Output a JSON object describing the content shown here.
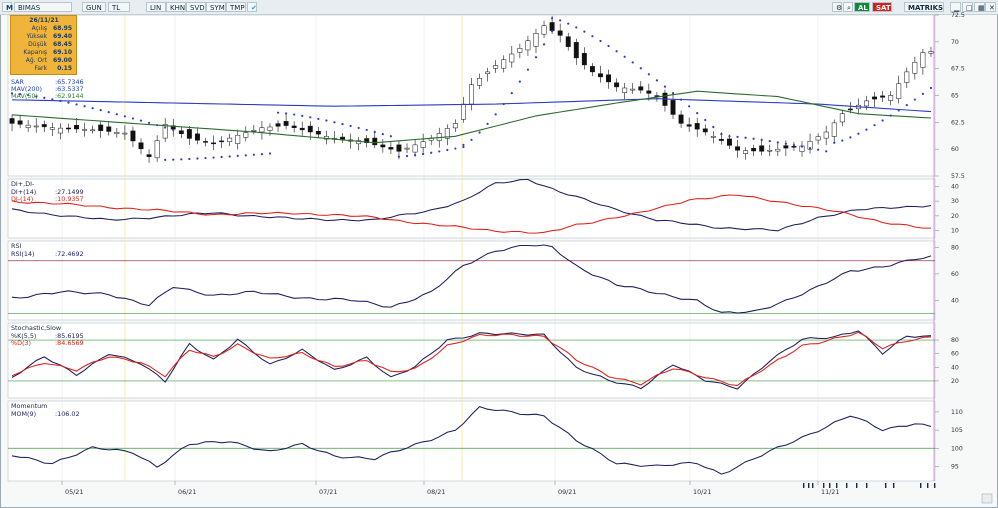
{
  "toolbar": {
    "logo": "M",
    "symbol": "BIMAS",
    "buttons": [
      "GUN",
      "TL",
      "LIN",
      "KHN",
      "SVD",
      "SYM",
      "TMP"
    ],
    "right_al": "AL",
    "right_sat": "SAT",
    "right_matriks": "MATRIKS",
    "colors": {
      "al": "#0c8a34",
      "sat": "#d6201d"
    }
  },
  "info_box": {
    "date": "26/11/21",
    "rows": [
      {
        "label": "Açılış",
        "value": "68.95"
      },
      {
        "label": "Yüksek",
        "value": "69.40"
      },
      {
        "label": "Düşük",
        "value": "68.45"
      },
      {
        "label": "Kapanış",
        "value": "69.10"
      },
      {
        "label": "Ağ. Ort",
        "value": "69.00"
      },
      {
        "label": "Fark",
        "value": "0.15"
      }
    ]
  },
  "x_axis": {
    "labels": [
      "05/21",
      "06/21",
      "07/21",
      "08/21",
      "09/21",
      "10/21",
      "11/21"
    ]
  },
  "chart_data": [
    {
      "type": "candlestick",
      "title": "",
      "legend": [
        {
          "name": "SAR",
          "value": ":65.7346",
          "color": "#1f3fbf"
        },
        {
          "name": "MAV(200)",
          "value": ":63.5337",
          "color": "#1f3fbf"
        },
        {
          "name": "MAV(50)",
          "value": ":62.9144",
          "color": "#2f7d32"
        }
      ],
      "ylim": [
        57.5,
        72.5
      ],
      "yticks": [
        57.5,
        60,
        62.5,
        65,
        67.5,
        70,
        72.5
      ],
      "n": 115,
      "close_anchors": [
        [
          0,
          62.4
        ],
        [
          5,
          62.0
        ],
        [
          10,
          61.8
        ],
        [
          14,
          61.5
        ],
        [
          17,
          59.3
        ],
        [
          19,
          62.3
        ],
        [
          22,
          61.0
        ],
        [
          25,
          60.5
        ],
        [
          28,
          61.3
        ],
        [
          31,
          62.0
        ],
        [
          34,
          62.2
        ],
        [
          37,
          61.6
        ],
        [
          40,
          61.0
        ],
        [
          43,
          60.8
        ],
        [
          46,
          60.2
        ],
        [
          48,
          59.8
        ],
        [
          52,
          61.0
        ],
        [
          55,
          62.4
        ],
        [
          57,
          66.0
        ],
        [
          60,
          67.8
        ],
        [
          63,
          69.4
        ],
        [
          66,
          71.5
        ],
        [
          68,
          70.6
        ],
        [
          70,
          68.5
        ],
        [
          72,
          67.2
        ],
        [
          75,
          65.8
        ],
        [
          78,
          65.5
        ],
        [
          80,
          64.9
        ],
        [
          83,
          62.4
        ],
        [
          86,
          61.6
        ],
        [
          88,
          60.8
        ],
        [
          90,
          59.9
        ],
        [
          93,
          59.8
        ],
        [
          95,
          60.0
        ],
        [
          98,
          60.3
        ],
        [
          101,
          61.6
        ],
        [
          103,
          63.3
        ],
        [
          106,
          64.5
        ],
        [
          109,
          65.0
        ],
        [
          111,
          67.2
        ],
        [
          113,
          69.0
        ],
        [
          114,
          69.1
        ]
      ],
      "mav200": [
        [
          0,
          64.6
        ],
        [
          20,
          64.3
        ],
        [
          40,
          64.0
        ],
        [
          60,
          64.2
        ],
        [
          80,
          64.7
        ],
        [
          100,
          64.2
        ],
        [
          114,
          63.5
        ]
      ],
      "mav50": [
        [
          0,
          63.2
        ],
        [
          15,
          62.4
        ],
        [
          30,
          61.6
        ],
        [
          45,
          60.6
        ],
        [
          55,
          61.2
        ],
        [
          65,
          63.1
        ],
        [
          75,
          64.3
        ],
        [
          85,
          65.4
        ],
        [
          95,
          64.9
        ],
        [
          105,
          63.3
        ],
        [
          114,
          62.9
        ]
      ],
      "sar_segments": [
        {
          "from": 0,
          "to": 20,
          "start": 65.2,
          "end": 61.8
        },
        {
          "from": 19,
          "to": 32,
          "start": 59.0,
          "end": 59.6
        },
        {
          "from": 33,
          "to": 47,
          "start": 63.4,
          "end": 61.2
        },
        {
          "from": 48,
          "to": 56,
          "start": 59.3,
          "end": 60.2
        },
        {
          "from": 56,
          "to": 67,
          "start": 60.4,
          "end": 71.0
        },
        {
          "from": 67,
          "to": 88,
          "start": 72.2,
          "end": 61.4
        },
        {
          "from": 89,
          "to": 101,
          "start": 61.2,
          "end": 59.8
        },
        {
          "from": 102,
          "to": 114,
          "start": 60.6,
          "end": 65.7
        }
      ]
    },
    {
      "type": "line",
      "title": "DI+,DI-",
      "legend": [
        {
          "name": "DI+(14)",
          "value": ":27.1499",
          "color": "#1b1f5e"
        },
        {
          "name": "DI-(14)",
          "value": ":10.9357",
          "color": "#e0201a"
        }
      ],
      "ylim": [
        5,
        45
      ],
      "yticks": [
        10,
        20,
        30,
        40
      ],
      "series": [
        {
          "name": "DI+(14)",
          "anchors": [
            [
              0,
              24
            ],
            [
              12,
              17
            ],
            [
              25,
              22
            ],
            [
              35,
              18
            ],
            [
              45,
              17
            ],
            [
              52,
              24
            ],
            [
              56,
              30
            ],
            [
              60,
              42
            ],
            [
              64,
              45
            ],
            [
              68,
              36
            ],
            [
              74,
              26
            ],
            [
              80,
              17
            ],
            [
              88,
              12
            ],
            [
              95,
              10
            ],
            [
              100,
              19
            ],
            [
              105,
              24
            ],
            [
              110,
              26
            ],
            [
              114,
              27.1
            ]
          ]
        },
        {
          "name": "DI-(14)",
          "anchors": [
            [
              0,
              30
            ],
            [
              12,
              26
            ],
            [
              25,
              21
            ],
            [
              35,
              22
            ],
            [
              45,
              19
            ],
            [
              52,
              14
            ],
            [
              60,
              10
            ],
            [
              66,
              8
            ],
            [
              70,
              14
            ],
            [
              78,
              22
            ],
            [
              84,
              31
            ],
            [
              90,
              34
            ],
            [
              96,
              29
            ],
            [
              103,
              22
            ],
            [
              108,
              16
            ],
            [
              114,
              10.9
            ]
          ]
        }
      ]
    },
    {
      "type": "line",
      "title": "RSI",
      "legend": [
        {
          "name": "RSI(14)",
          "value": ":72.4692",
          "color": "#1b1f5e"
        }
      ],
      "ylim": [
        25,
        85
      ],
      "yticks": [
        40,
        60,
        80
      ],
      "reference_lines": [
        70,
        30
      ],
      "series": [
        {
          "name": "RSI(14)",
          "anchors": [
            [
              0,
              42
            ],
            [
              6,
              46
            ],
            [
              12,
              45
            ],
            [
              17,
              36
            ],
            [
              20,
              50
            ],
            [
              25,
              44
            ],
            [
              30,
              46
            ],
            [
              36,
              42
            ],
            [
              42,
              40
            ],
            [
              47,
              35
            ],
            [
              52,
              46
            ],
            [
              56,
              66
            ],
            [
              60,
              78
            ],
            [
              64,
              82
            ],
            [
              67,
              80
            ],
            [
              70,
              66
            ],
            [
              75,
              52
            ],
            [
              80,
              45
            ],
            [
              85,
              40
            ],
            [
              88,
              30
            ],
            [
              92,
              31
            ],
            [
              96,
              40
            ],
            [
              100,
              50
            ],
            [
              104,
              62
            ],
            [
              108,
              66
            ],
            [
              112,
              71
            ],
            [
              114,
              72.5
            ]
          ]
        }
      ]
    },
    {
      "type": "line",
      "title": "Stochastic,Slow",
      "legend": [
        {
          "name": "%K(5,5)",
          "value": ":85.6195",
          "color": "#1b1f5e"
        },
        {
          "name": "%D(3)",
          "value": ":84.6569",
          "color": "#e0201a"
        }
      ],
      "ylim": [
        -5,
        105
      ],
      "yticks": [
        20,
        40,
        60,
        80
      ],
      "reference_lines": [
        80,
        20
      ],
      "series": [
        {
          "name": "%K(5,5)",
          "anchors": [
            [
              0,
              25
            ],
            [
              4,
              55
            ],
            [
              8,
              30
            ],
            [
              12,
              60
            ],
            [
              16,
              45
            ],
            [
              19,
              20
            ],
            [
              22,
              75
            ],
            [
              25,
              50
            ],
            [
              28,
              80
            ],
            [
              32,
              45
            ],
            [
              36,
              65
            ],
            [
              40,
              35
            ],
            [
              44,
              55
            ],
            [
              47,
              25
            ],
            [
              50,
              40
            ],
            [
              54,
              80
            ],
            [
              58,
              90
            ],
            [
              62,
              88
            ],
            [
              66,
              88
            ],
            [
              70,
              40
            ],
            [
              74,
              20
            ],
            [
              78,
              10
            ],
            [
              82,
              45
            ],
            [
              86,
              20
            ],
            [
              90,
              10
            ],
            [
              94,
              50
            ],
            [
              98,
              80
            ],
            [
              102,
              85
            ],
            [
              105,
              95
            ],
            [
              108,
              60
            ],
            [
              111,
              85
            ],
            [
              114,
              85.6
            ]
          ]
        },
        {
          "name": "%D(3)",
          "anchors": [
            [
              0,
              28
            ],
            [
              4,
              48
            ],
            [
              8,
              36
            ],
            [
              12,
              55
            ],
            [
              16,
              48
            ],
            [
              19,
              28
            ],
            [
              22,
              65
            ],
            [
              25,
              55
            ],
            [
              28,
              74
            ],
            [
              32,
              52
            ],
            [
              36,
              60
            ],
            [
              40,
              42
            ],
            [
              44,
              50
            ],
            [
              47,
              32
            ],
            [
              50,
              38
            ],
            [
              54,
              72
            ],
            [
              58,
              86
            ],
            [
              62,
              88
            ],
            [
              66,
              86
            ],
            [
              70,
              50
            ],
            [
              74,
              28
            ],
            [
              78,
              16
            ],
            [
              82,
              38
            ],
            [
              86,
              26
            ],
            [
              90,
              14
            ],
            [
              94,
              42
            ],
            [
              98,
              72
            ],
            [
              102,
              82
            ],
            [
              105,
              90
            ],
            [
              108,
              68
            ],
            [
              111,
              80
            ],
            [
              114,
              84.7
            ]
          ]
        }
      ]
    },
    {
      "type": "line",
      "title": "Momentum",
      "legend": [
        {
          "name": "MOM(9)",
          "value": ":106.02",
          "color": "#1b1f5e"
        }
      ],
      "ylim": [
        91,
        113
      ],
      "yticks": [
        95,
        100,
        105,
        110
      ],
      "reference_lines": [
        100
      ],
      "series": [
        {
          "name": "MOM(9)",
          "anchors": [
            [
              0,
              98
            ],
            [
              5,
              96
            ],
            [
              10,
              100
            ],
            [
              15,
              99
            ],
            [
              18,
              95
            ],
            [
              22,
              101
            ],
            [
              27,
              102
            ],
            [
              32,
              99
            ],
            [
              36,
              101
            ],
            [
              40,
              98
            ],
            [
              45,
              97
            ],
            [
              50,
              101
            ],
            [
              55,
              105
            ],
            [
              58,
              111
            ],
            [
              62,
              110
            ],
            [
              66,
              109
            ],
            [
              70,
              102
            ],
            [
              75,
              96
            ],
            [
              80,
              95
            ],
            [
              85,
              96
            ],
            [
              88,
              93
            ],
            [
              91,
              96
            ],
            [
              95,
              100
            ],
            [
              99,
              104
            ],
            [
              102,
              107
            ],
            [
              104,
              109
            ],
            [
              108,
              105
            ],
            [
              112,
              107
            ],
            [
              114,
              106
            ]
          ]
        }
      ]
    }
  ]
}
